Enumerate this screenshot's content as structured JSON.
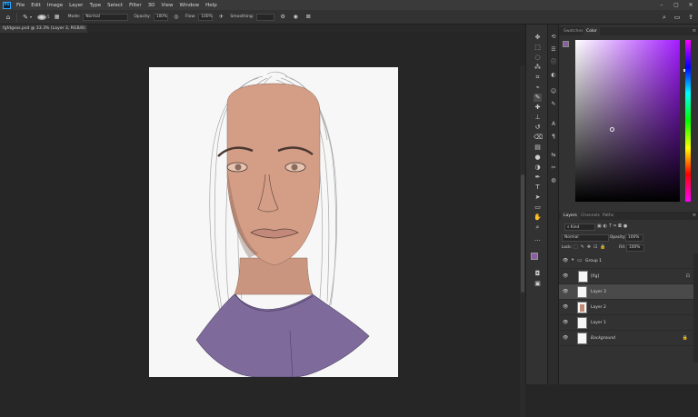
{
  "app": {
    "logo_text": "Ps",
    "accent": "#31a8ff"
  },
  "menu": [
    "File",
    "Edit",
    "Image",
    "Layer",
    "Type",
    "Select",
    "Filter",
    "3D",
    "View",
    "Window",
    "Help"
  ],
  "window_controls": {
    "minimize": "–",
    "maximize": "▢",
    "close": "✕"
  },
  "options": {
    "mode_label": "Mode:",
    "mode_value": "Normal",
    "opacity_label": "Opacity:",
    "opacity_value": "100%",
    "flow_label": "Flow:",
    "flow_value": "100%",
    "smoothing_label": "Smoothing:",
    "smoothing_value": "",
    "brush_size": "5"
  },
  "document": {
    "tab_title": "fgfdgsos.psd @ 33.3% (Layer 3, RGB/8) *",
    "tab_close": "×"
  },
  "panels": {
    "top_tabs": [
      "Swatches",
      "Color"
    ],
    "top_active": "Color",
    "layer_tabs": [
      "Layers",
      "Channels",
      "Paths"
    ],
    "layer_active": "Layers",
    "kind_label": "Kind",
    "blend_mode": "Normal",
    "opacity_label": "Opacity:",
    "opacity_value": "100%",
    "lock_label": "Lock:",
    "fill_label": "Fill:",
    "fill_value": "100%"
  },
  "colors": {
    "foreground": "#8a5ea0",
    "background": "#ffffff",
    "picker_hue": "#a21dff"
  },
  "layers": [
    {
      "name": "Group 1",
      "type": "group"
    },
    {
      "name": "[fig]",
      "type": "smart"
    },
    {
      "name": "Layer 3",
      "type": "layer",
      "selected": true
    },
    {
      "name": "Layer 2",
      "type": "layer"
    },
    {
      "name": "Layer 1",
      "type": "layer"
    },
    {
      "name": "Background",
      "type": "background"
    }
  ],
  "icons": {
    "home": "⌂",
    "brush": "✎",
    "search": "⌕",
    "workspace": "▭",
    "share": "⇪"
  }
}
